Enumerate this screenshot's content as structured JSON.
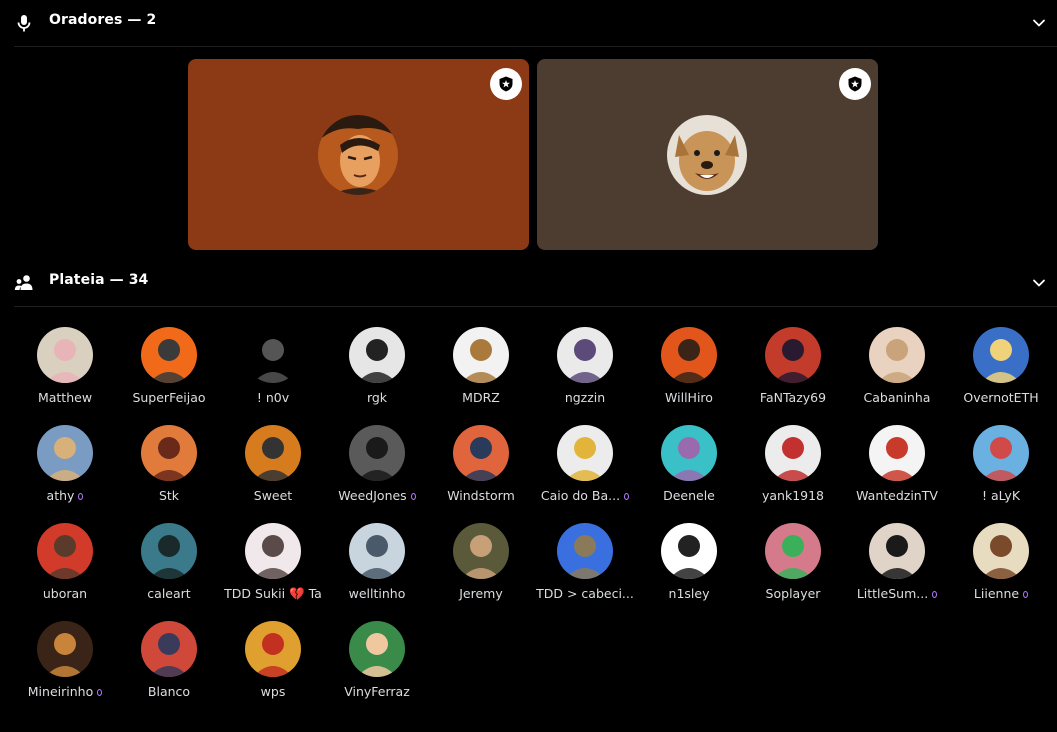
{
  "speakers_section": {
    "title": "Oradores — 2",
    "icon": "microphone-icon",
    "speakers": [
      {
        "bg": "#8b3a15",
        "avatar_style": "anime-warrior"
      },
      {
        "bg": "#4d3d31",
        "avatar_style": "dog"
      }
    ]
  },
  "audience_section": {
    "title": "Plateia — 34",
    "icon": "people-icon",
    "members": [
      {
        "name": "Matthew",
        "bg": "#d9d0c0",
        "fg": "#e8b4b8"
      },
      {
        "name": "SuperFeijao",
        "bg": "#f06a1a",
        "fg": "#3a3a3a"
      },
      {
        "name": "! n0v",
        "bg": "#000000",
        "fg": "#555555"
      },
      {
        "name": "rgk",
        "bg": "#e6e6e6",
        "fg": "#222222"
      },
      {
        "name": "MDRZ",
        "bg": "#f2f2f2",
        "fg": "#a97a3c"
      },
      {
        "name": "ngzzin",
        "bg": "#eaeaea",
        "fg": "#5c4b7a"
      },
      {
        "name": "WillHiro",
        "bg": "#e2561c",
        "fg": "#3a2418"
      },
      {
        "name": "FaNTazy69",
        "bg": "#c23b2b",
        "fg": "#2a1a30"
      },
      {
        "name": "Cabaninha",
        "bg": "#e9d2bf",
        "fg": "#c9a37a"
      },
      {
        "name": "OvernotETH",
        "bg": "#3a6fc7",
        "fg": "#f0d27a"
      },
      {
        "name": "athy",
        "bg": "#7a9bc2",
        "fg": "#d8b07a",
        "badge": true
      },
      {
        "name": "Stk",
        "bg": "#e07b3c",
        "fg": "#6a2a1a"
      },
      {
        "name": "Sweet",
        "bg": "#d77b1f",
        "fg": "#333333"
      },
      {
        "name": "WeedJones",
        "bg": "#5a5a5a",
        "fg": "#1a1a1a",
        "badge": true
      },
      {
        "name": "Windstorm",
        "bg": "#e0643c",
        "fg": "#2a3a5a"
      },
      {
        "name": "Caio do Ba...",
        "bg": "#ececec",
        "fg": "#e2b53a",
        "badge": true
      },
      {
        "name": "Deenele",
        "bg": "#3ac0c7",
        "fg": "#9a6ab0"
      },
      {
        "name": "yank1918",
        "bg": "#ececec",
        "fg": "#c23030"
      },
      {
        "name": "WantedzinTV",
        "bg": "#f4f4f4",
        "fg": "#c83a2a"
      },
      {
        "name": "! aLyK",
        "bg": "#6ab0e0",
        "fg": "#d04a4a"
      },
      {
        "name": "uboran",
        "bg": "#d23a2a",
        "fg": "#5a3a2a"
      },
      {
        "name": "caleart",
        "bg": "#3a7a8a",
        "fg": "#1a2a2a"
      },
      {
        "name": "TDD Sukii 💔 Ta",
        "bg": "#f0e8ea",
        "fg": "#5a4a4a"
      },
      {
        "name": "welltinho",
        "bg": "#c8d4de",
        "fg": "#4a5a6a"
      },
      {
        "name": "Jeremy",
        "bg": "#5a5a3a",
        "fg": "#c8a078"
      },
      {
        "name": "TDD > cabeci...",
        "bg": "#3a6fe0",
        "fg": "#8a7a5a"
      },
      {
        "name": "n1sley",
        "bg": "#ffffff",
        "fg": "#222222"
      },
      {
        "name": "Soplayer",
        "bg": "#d47a8a",
        "fg": "#3ab05a"
      },
      {
        "name": "LittleSum...",
        "bg": "#e0d4c8",
        "fg": "#1a1a1a",
        "badge": true
      },
      {
        "name": "Liienne",
        "bg": "#e8dcc0",
        "fg": "#7a4a2a",
        "badge": true
      },
      {
        "name": "Mineirinho",
        "bg": "#3a2418",
        "fg": "#c8843a",
        "badge": true
      },
      {
        "name": "Blanco",
        "bg": "#d0483a",
        "fg": "#3a3a5a"
      },
      {
        "name": "wps",
        "bg": "#e0a030",
        "fg": "#c23020"
      },
      {
        "name": "VinyFerraz",
        "bg": "#3a8a4a",
        "fg": "#f0c8a0"
      }
    ]
  },
  "colors": {
    "background": "#000000",
    "text": "#ffffff",
    "muted_text": "#dbdee1",
    "nitro_badge": "#b378ff"
  }
}
